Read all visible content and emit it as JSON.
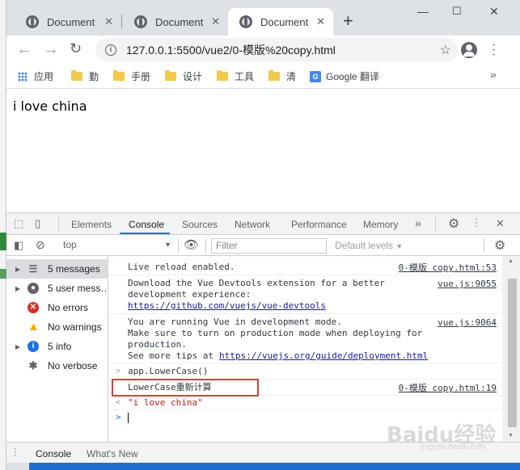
{
  "tabs": [
    {
      "title": "Document"
    },
    {
      "title": "Document"
    },
    {
      "title": "Document"
    }
  ],
  "address": {
    "url": "127.0.0.1:5500/vue2/0-模版%20copy.html"
  },
  "bookmarks": [
    "应用",
    "勤",
    "手册",
    "设计",
    "工具",
    "清",
    "Google 翻译"
  ],
  "page": {
    "text": "i love china"
  },
  "devtools": {
    "tabs": [
      "Elements",
      "Console",
      "Sources",
      "Network",
      "Performance",
      "Memory"
    ],
    "context": "top",
    "filter_placeholder": "Filter",
    "levels": "Default levels",
    "sidebar": [
      {
        "label": "5 messages"
      },
      {
        "label": "5 user mess…"
      },
      {
        "label": "No errors"
      },
      {
        "label": "No warnings"
      },
      {
        "label": "5 info"
      },
      {
        "label": "No verbose"
      }
    ],
    "console": {
      "l1": "Live reload enabled.",
      "l1_src": "0-模版 copy.html:53",
      "l2a": "Download the Vue Devtools extension for a better",
      "l2b": "development experience:",
      "l2_link": "https://github.com/vuejs/vue-devtools",
      "l2_src": "vue.js:9055",
      "l3a": "You are running Vue in development mode.",
      "l3b": "Make sure to turn on production mode when deploying for",
      "l3c": "production.",
      "l3d": "See more tips at",
      "l3_link": "https://vuejs.org/guide/deployment.html",
      "l3_src": "vue.js:9064",
      "l4": "app.LowerCase()",
      "l5": "LowerCase重新计算",
      "l5_src": "0-模版 copy.html:19",
      "l6": "\"i love china\""
    },
    "drawer_tabs": [
      "Console",
      "What's New"
    ]
  },
  "watermark": {
    "text": "Baidu经验",
    "sub": "jingyan.baidu.com"
  },
  "colors": {
    "accent": "#1a73e8",
    "highlight": "#e53935",
    "error": "#d93025",
    "warning": "#f9ab00",
    "info": "#1a73e8"
  }
}
